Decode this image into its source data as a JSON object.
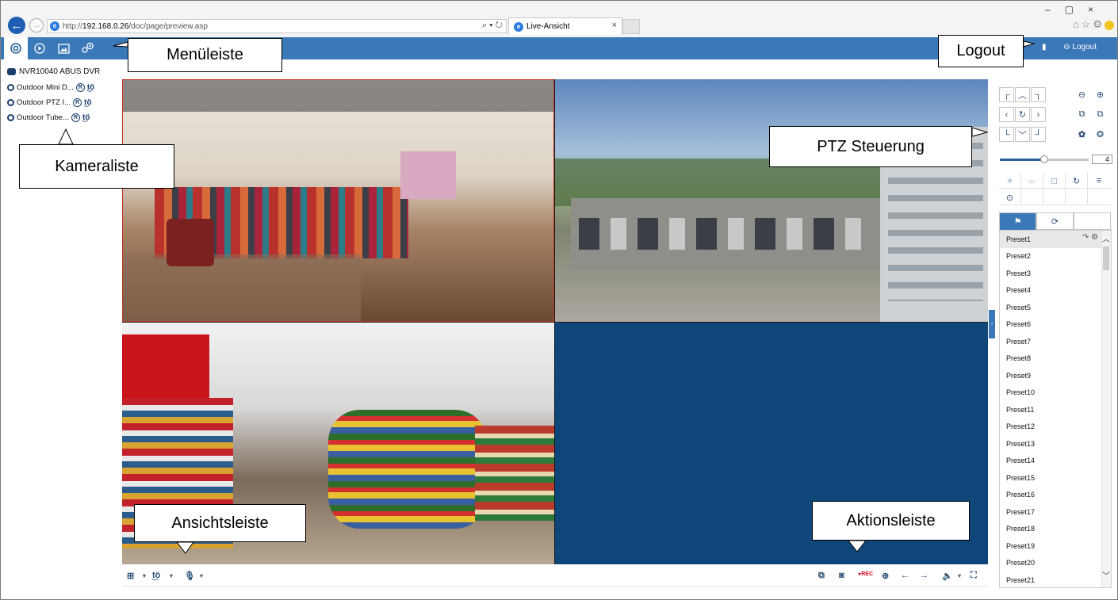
{
  "browser": {
    "url_prefix": "http://",
    "url_host": "192.168.0.26",
    "url_path": "/doc/page/preview.asp",
    "tab_title": "Live-Ansicht",
    "tab_close": "×",
    "addr_tools": "⌕ ▾ ↻",
    "window_controls": "–▢×",
    "right_icons": "⌂☆⚙"
  },
  "appbar": {
    "logout": "⊖ Logout"
  },
  "camera_list": {
    "device": "NVR10040 ABUS DVR",
    "cameras": [
      {
        "name": "Outdoor Mini D..."
      },
      {
        "name": "Outdoor PTZ I..."
      },
      {
        "name": "Outdoor Tube..."
      }
    ],
    "rec_badge": "R",
    "ptz_glyph": "t͜ö"
  },
  "ptz": {
    "speed": "4",
    "speed_fraction": 0.5,
    "presets": [
      "Preset1",
      "Preset2",
      "Preset3",
      "Preset4",
      "Preset5",
      "Preset6",
      "Preset7",
      "Preset8",
      "Preset9",
      "Preset10",
      "Preset11",
      "Preset12",
      "Preset13",
      "Preset14",
      "Preset15",
      "Preset16",
      "Preset17",
      "Preset18",
      "Preset19",
      "Preset20",
      "Preset21"
    ]
  },
  "toolbar": {
    "rec": "●REC"
  },
  "callouts": {
    "menu": "Menüleiste",
    "logout": "Logout",
    "cameras": "Kameraliste",
    "ptz": "PTZ Steuerung",
    "view": "Ansichtsleiste",
    "actions": "Aktionsleiste"
  },
  "colors": {
    "accent": "#3b78b8",
    "empty_tile": "#0f467a",
    "rec_red": "#d0021b"
  }
}
